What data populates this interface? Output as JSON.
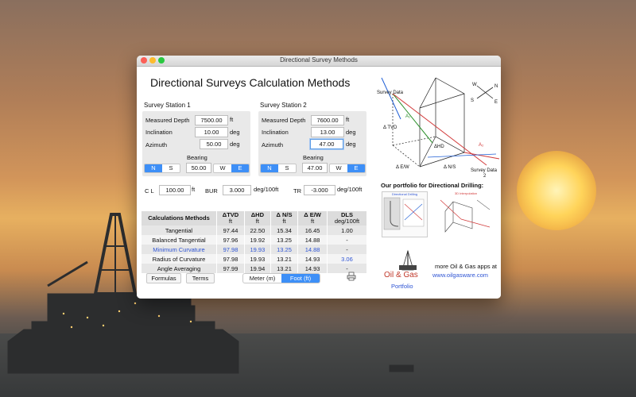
{
  "window": {
    "title": "Directional Survey Methods"
  },
  "app_title": "Directional Surveys Calculation Methods",
  "station1": {
    "title": "Survey Station 1",
    "md_label": "Measured Depth",
    "md": "7500.00",
    "md_unit": "ft",
    "inc_label": "Inclination",
    "inc": "10.00",
    "inc_unit": "deg",
    "az_label": "Azimuth",
    "az": "50.00",
    "az_unit": "deg",
    "bearing_label": "Bearing",
    "ns": [
      "N",
      "S"
    ],
    "bearing": "50.00",
    "ew": [
      "W",
      "E"
    ]
  },
  "station2": {
    "title": "Survey Station 2",
    "md_label": "Measured Depth",
    "md": "7600.00",
    "md_unit": "ft",
    "inc_label": "Inclination",
    "inc": "13.00",
    "inc_unit": "deg",
    "az_label": "Azimuth",
    "az": "47.00",
    "az_unit": "deg",
    "bearing_label": "Bearing",
    "ns": [
      "N",
      "S"
    ],
    "bearing": "47.00",
    "ew": [
      "W",
      "E"
    ]
  },
  "params": {
    "cl_label": "C L",
    "cl": "100.00",
    "cl_unit": "ft",
    "bur_label": "BUR",
    "bur": "3.000",
    "bur_unit": "deg/100ft",
    "tr_label": "TR",
    "tr": "-3.000",
    "tr_unit": "deg/100ft"
  },
  "table": {
    "headers": [
      {
        "label": "Calculations Methods",
        "sub": ""
      },
      {
        "label": "ΔTVD",
        "sub": "ft"
      },
      {
        "label": "ΔHD",
        "sub": "ft"
      },
      {
        "label": "Δ N/S",
        "sub": "ft"
      },
      {
        "label": "Δ E/W",
        "sub": "ft"
      },
      {
        "label": "DLS",
        "sub": "deg/100ft"
      }
    ],
    "rows": [
      [
        "Tangential",
        "97.44",
        "22.50",
        "15.34",
        "16.45",
        "1.00"
      ],
      [
        "Balanced Tangential",
        "97.96",
        "19.92",
        "13.25",
        "14.88",
        "-"
      ],
      [
        "Minimum Curvature",
        "97.98",
        "19.93",
        "13.25",
        "14.88",
        "-"
      ],
      [
        "Radius of Curvature",
        "97.98",
        "19.93",
        "13.21",
        "14.93",
        "3.06"
      ],
      [
        "Angle Averaging",
        "97.99",
        "19.94",
        "13.21",
        "14.93",
        "-"
      ]
    ]
  },
  "buttons": {
    "formulas": "Formulas",
    "terms": "Terms",
    "meter": "Meter (m)",
    "foot": "Foot (ft)"
  },
  "diagram": {
    "survey_data": "Survey Data",
    "survey_data2": "Survey Data",
    "survey_data2_num": "2",
    "a1": "A₁",
    "a2": "A₂",
    "dtvd": "Δ TVD",
    "dhd": "ΔHD",
    "dns": "Δ N/S",
    "dew": "Δ E/W",
    "compass": {
      "w": "W",
      "n": "N",
      "s": "S",
      "e": "E"
    }
  },
  "portfolio": {
    "heading": "Our portfolio for Directional Drilling:",
    "thumb1_caption": "Directional Drilling",
    "thumb2_caption": "3D Interpolation",
    "logo_text": "Oil & Gas",
    "portfolio_link": "Portfolio",
    "more_text": "more Oil & Gas apps at",
    "url": "www.oilgasware.com"
  }
}
